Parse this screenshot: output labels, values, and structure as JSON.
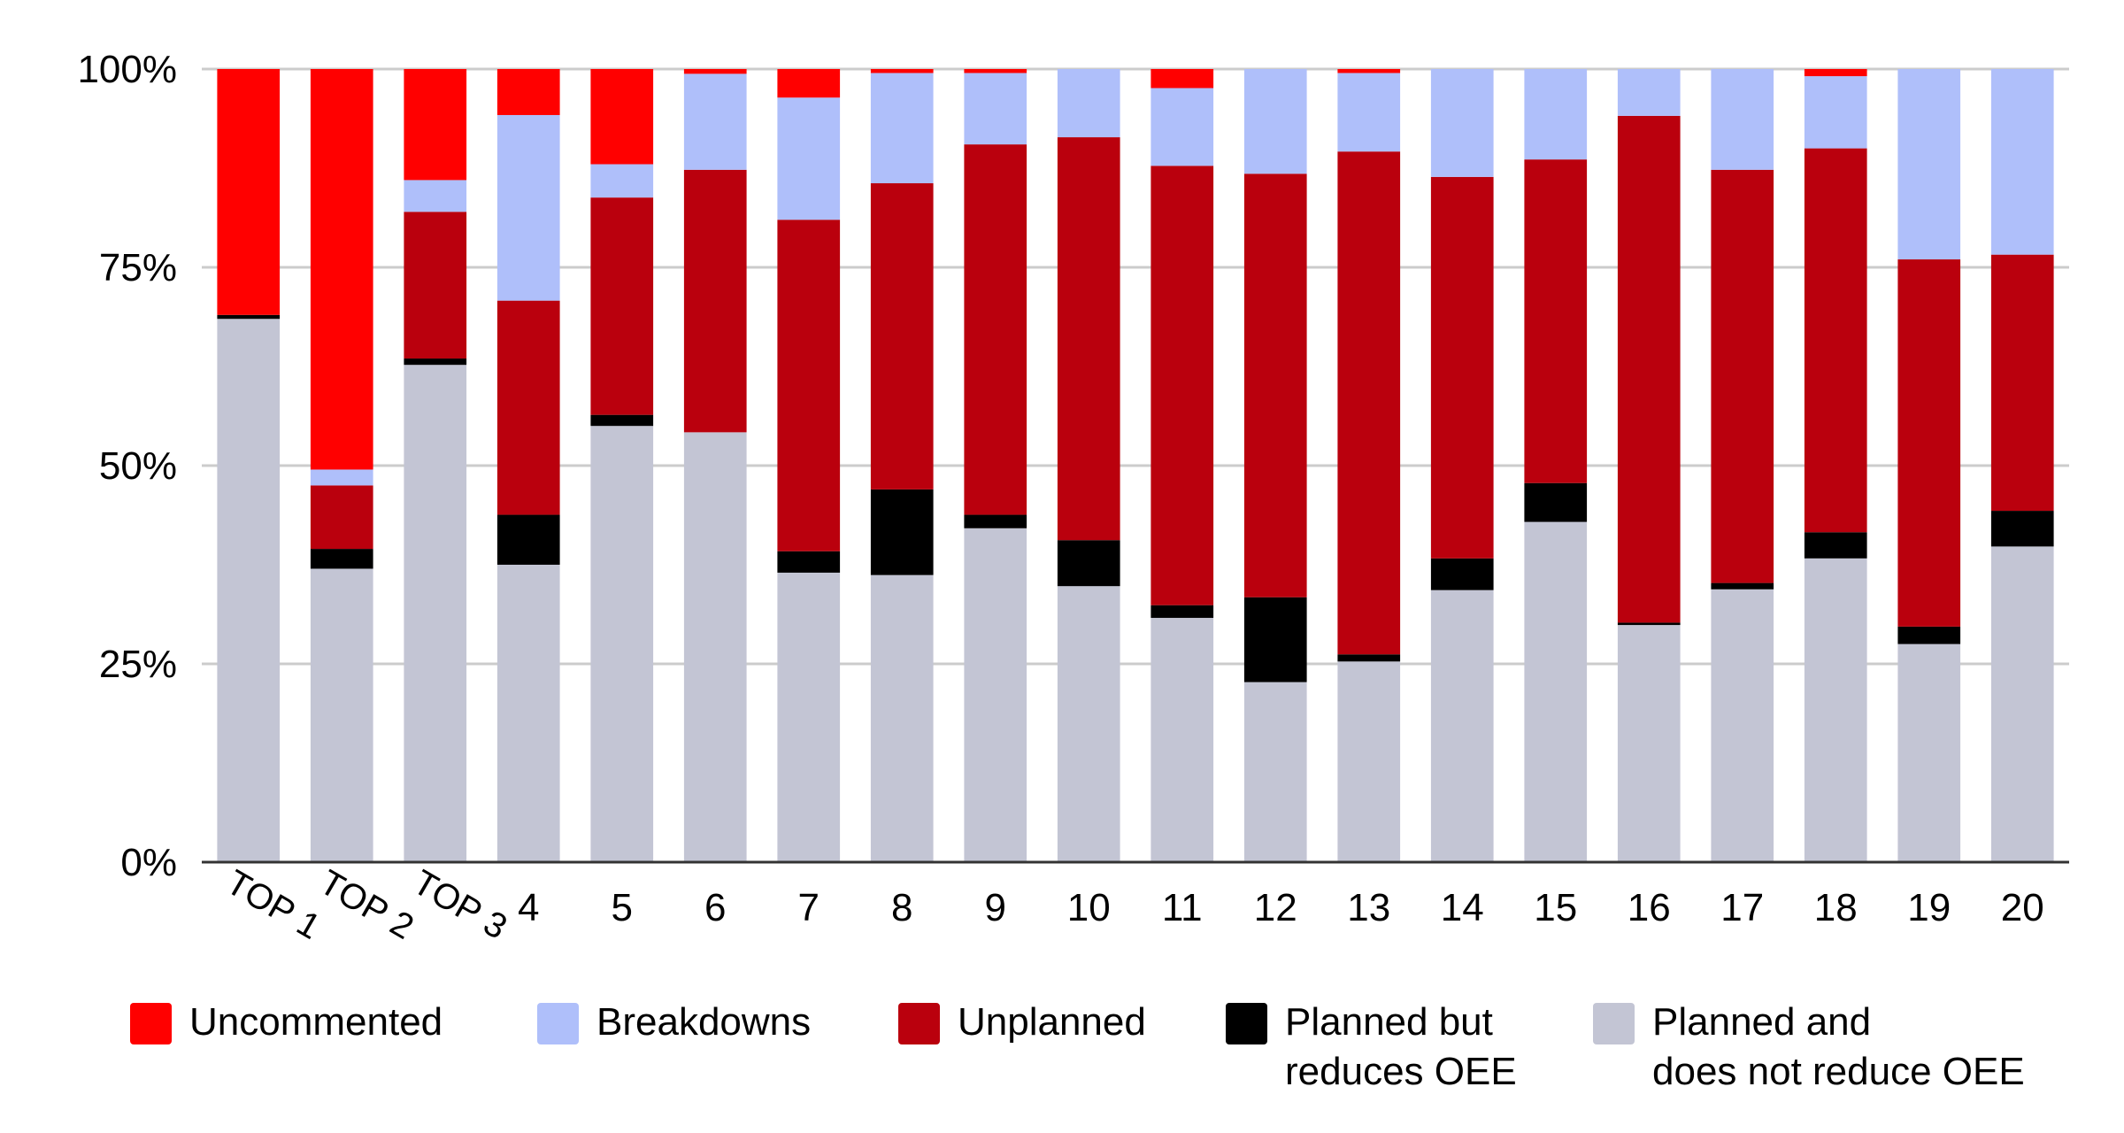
{
  "chart_data": {
    "type": "bar",
    "stacked": true,
    "normalized": true,
    "title": "",
    "xlabel": "",
    "ylabel": "",
    "ylim": [
      0,
      100
    ],
    "yticks": [
      "0%",
      "25%",
      "50%",
      "75%",
      "100%"
    ],
    "ytick_values": [
      0,
      25,
      50,
      75,
      100
    ],
    "grid": true,
    "legend_position": "bottom",
    "categories": [
      "TOP 1",
      "TOP 2",
      "TOP 3",
      "4",
      "5",
      "6",
      "7",
      "8",
      "9",
      "10",
      "11",
      "12",
      "13",
      "14",
      "15",
      "16",
      "17",
      "18",
      "19",
      "20"
    ],
    "series": [
      {
        "name": "Planned and does not reduce OEE",
        "color": "#c3c5d4",
        "values": [
          68.5,
          37.0,
          62.7,
          37.5,
          55.0,
          54.2,
          36.5,
          36.2,
          42.1,
          34.8,
          30.8,
          22.7,
          25.3,
          34.3,
          42.9,
          29.9,
          34.4,
          38.3,
          27.5,
          39.8
        ]
      },
      {
        "name": "Planned but reduces OEE",
        "color": "#000000",
        "values": [
          0.5,
          2.5,
          0.8,
          6.3,
          1.4,
          0.0,
          2.7,
          10.8,
          1.7,
          5.8,
          1.6,
          10.7,
          0.9,
          4.0,
          4.9,
          0.3,
          0.8,
          3.3,
          2.2,
          4.5
        ]
      },
      {
        "name": "Unplanned",
        "color": "#ba000d",
        "values": [
          0.0,
          8.0,
          18.5,
          27.0,
          27.4,
          33.1,
          41.8,
          38.6,
          46.7,
          50.8,
          55.4,
          53.4,
          63.4,
          48.1,
          40.8,
          63.9,
          52.1,
          48.4,
          46.3,
          32.3
        ]
      },
      {
        "name": "Breakdowns",
        "color": "#afbffa",
        "values": [
          0.0,
          2.0,
          4.0,
          23.4,
          4.2,
          12.1,
          15.4,
          13.9,
          9.0,
          8.6,
          9.8,
          13.2,
          9.9,
          13.6,
          11.4,
          5.9,
          12.7,
          9.1,
          24.0,
          23.4
        ]
      },
      {
        "name": "Uncommented",
        "color": "#ff0000",
        "values": [
          31.0,
          50.5,
          14.0,
          5.8,
          12.0,
          0.6,
          3.6,
          0.5,
          0.5,
          0.0,
          2.4,
          0.0,
          0.5,
          0.0,
          0.0,
          0.0,
          0.0,
          0.9,
          0.0,
          0.0
        ]
      }
    ],
    "rotated_labels": [
      "TOP 1",
      "TOP 2",
      "TOP 3"
    ]
  },
  "legend": [
    {
      "label": "Uncommented",
      "color": "#ff0000"
    },
    {
      "label": "Breakdowns",
      "color": "#afbffa"
    },
    {
      "label": "Unplanned",
      "color": "#ba000d"
    },
    {
      "label": "Planned but\nreduces OEE",
      "color": "#000000"
    },
    {
      "label": "Planned and\ndoes not reduce OEE",
      "color": "#c3c5d4"
    }
  ]
}
